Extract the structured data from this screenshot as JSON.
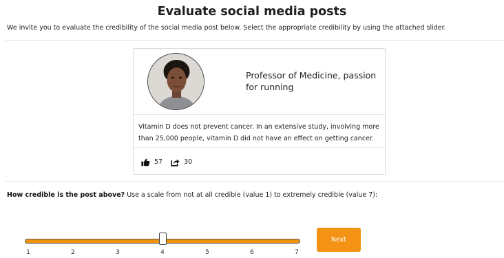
{
  "page": {
    "title": "Evaluate social media posts",
    "intro": "We invite you to evaluate the credibility of the social media post below. Select the appropriate credibility by using the attached slider."
  },
  "post": {
    "author_bio": "Professor of Medicine, passion for running",
    "text": "Vitamin D does not prevent cancer. In an extensive study, involving more than 25,000 people, vitamin D did not have an effect on getting cancer.",
    "likes": "57",
    "shares": "30",
    "like_icon": "thumbs-up-icon",
    "share_icon": "share-icon"
  },
  "rating": {
    "question_bold": "How credible is the post above?",
    "question_rest": " Use a scale from not at all credible (value 1) to extremely credible (value 7):",
    "scale": [
      "1",
      "2",
      "3",
      "4",
      "5",
      "6",
      "7"
    ],
    "current_value": 4,
    "min": 1,
    "max": 7,
    "accent_color": "#f39215"
  },
  "actions": {
    "next_label": "Next"
  }
}
